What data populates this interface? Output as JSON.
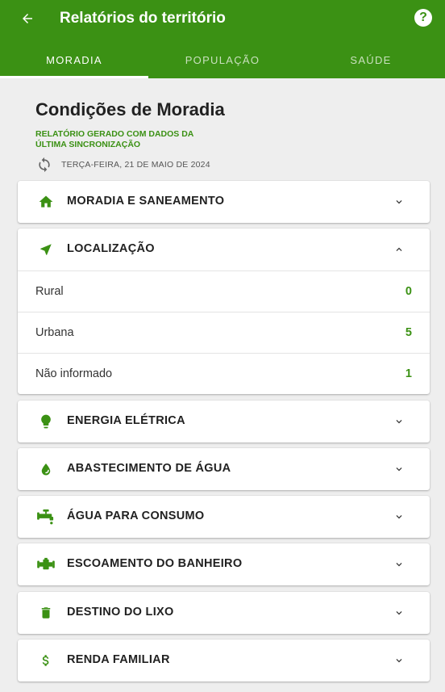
{
  "appbar": {
    "title": "Relatórios do território"
  },
  "tabs": [
    {
      "label": "MORADIA",
      "active": true
    },
    {
      "label": "POPULAÇÃO",
      "active": false
    },
    {
      "label": "SAÚDE",
      "active": false
    }
  ],
  "header": {
    "title": "Condições de Moradia",
    "report_note": "RELATÓRIO GERADO COM DADOS DA ÚLTIMA SINCRONIZAÇÃO",
    "sync_date": "TERÇA-FEIRA, 21 DE MAIO DE 2024"
  },
  "colors": {
    "primary": "#3b9114",
    "background": "#eeeeee"
  },
  "sections": [
    {
      "label": "MORADIA E SANEAMENTO",
      "icon": "home-icon",
      "expanded": false
    },
    {
      "label": "LOCALIZAÇÃO",
      "icon": "navigation-arrow-icon",
      "expanded": true,
      "rows": [
        {
          "label": "Rural",
          "value": "0"
        },
        {
          "label": "Urbana",
          "value": "5"
        },
        {
          "label": "Não informado",
          "value": "1"
        }
      ]
    },
    {
      "label": "ENERGIA ELÉTRICA",
      "icon": "lightbulb-icon",
      "expanded": false
    },
    {
      "label": "ABASTECIMENTO DE ÁGUA",
      "icon": "water-drop-icon",
      "expanded": false
    },
    {
      "label": "ÁGUA PARA CONSUMO",
      "icon": "faucet-icon",
      "expanded": false
    },
    {
      "label": "ESCOAMENTO DO BANHEIRO",
      "icon": "pipe-icon",
      "expanded": false
    },
    {
      "label": "DESTINO DO LIXO",
      "icon": "trash-icon",
      "expanded": false
    },
    {
      "label": "RENDA FAMILIAR",
      "icon": "dollar-icon",
      "expanded": false
    }
  ]
}
